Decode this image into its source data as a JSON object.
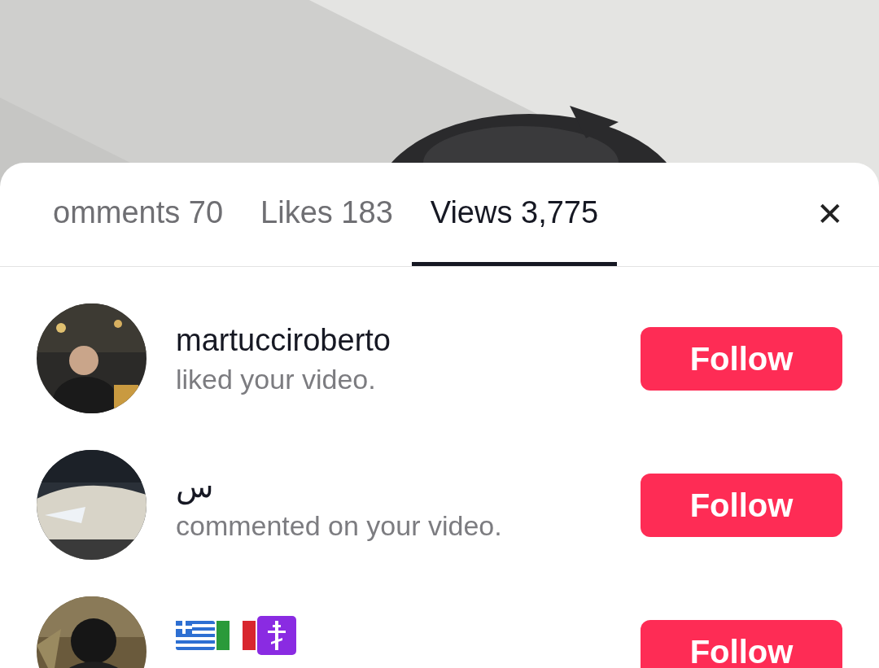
{
  "tabs": [
    {
      "label": "omments 70",
      "selected": false
    },
    {
      "label": "Likes 183",
      "selected": false
    },
    {
      "label": "Views 3,775",
      "selected": true
    }
  ],
  "close": {
    "label": "✕"
  },
  "activities": [
    {
      "kind": "text-name",
      "name": "martucciroberto",
      "action": "liked your video.",
      "button": "Follow"
    },
    {
      "kind": "text-name",
      "name": "س",
      "action": "commented on your video.",
      "button": "Follow"
    },
    {
      "kind": "flag-name",
      "button": "Follow"
    }
  ]
}
